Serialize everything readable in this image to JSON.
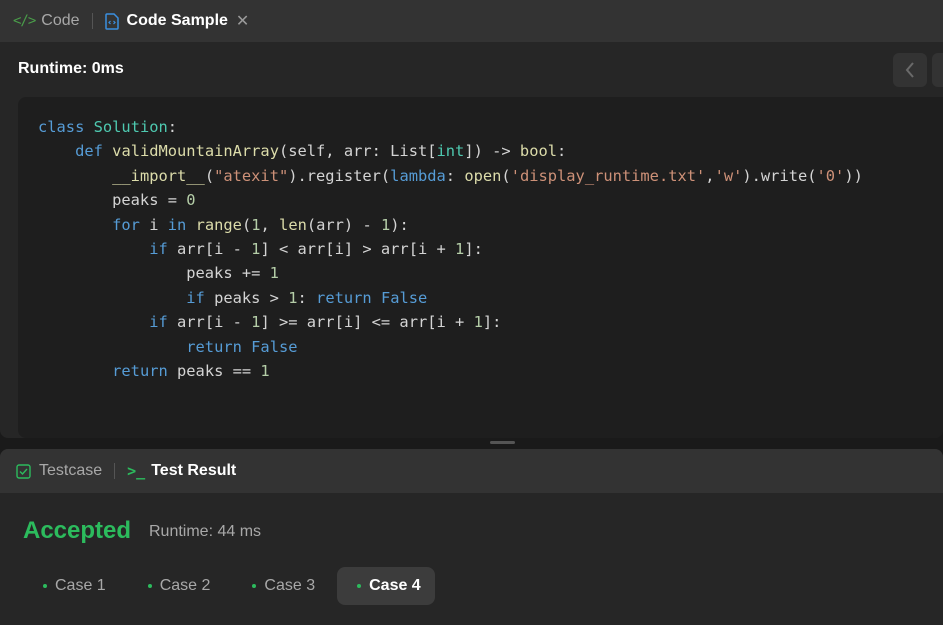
{
  "top_tabs": {
    "code_label": "Code",
    "sample_label": "Code Sample"
  },
  "runtime_label": "Runtime: 0ms",
  "code_lines": [
    "class Solution:",
    "    def validMountainArray(self, arr: List[int]) -> bool:",
    "        __import__(\"atexit\").register(lambda: open('display_runtime.txt','w').write('0'))",
    "        peaks = 0",
    "        for i in range(1, len(arr) - 1):",
    "            if arr[i - 1] < arr[i] > arr[i + 1]:",
    "                peaks += 1",
    "                if peaks > 1: return False",
    "            if arr[i - 1] >= arr[i] <= arr[i + 1]:",
    "                return False",
    "        return peaks == 1"
  ],
  "bottom_tabs": {
    "testcase_label": "Testcase",
    "result_label": "Test Result"
  },
  "result": {
    "status": "Accepted",
    "runtime": "Runtime: 44 ms"
  },
  "cases": [
    {
      "label": "Case 1",
      "active": false
    },
    {
      "label": "Case 2",
      "active": false
    },
    {
      "label": "Case 3",
      "active": false
    },
    {
      "label": "Case 4",
      "active": true
    }
  ],
  "colors": {
    "accent_green": "#2cbb5d",
    "panel_bg": "#262626",
    "tab_bg": "#333333"
  }
}
